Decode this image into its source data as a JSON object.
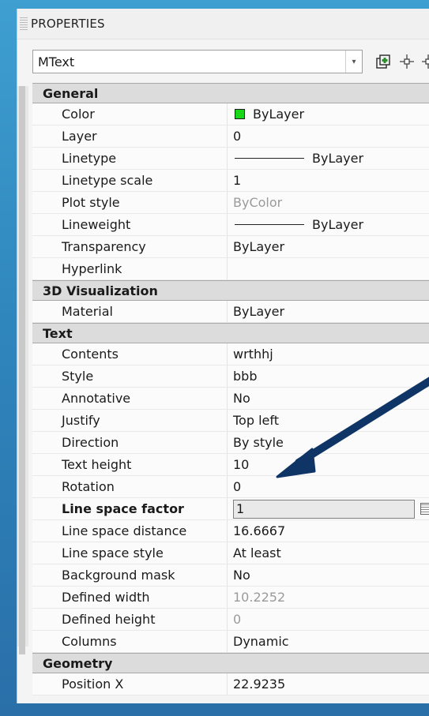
{
  "panel": {
    "title": "PROPERTIES"
  },
  "toolbar": {
    "selection": "MText",
    "buttons": [
      "quick-select-icon",
      "select-objects-icon",
      "toggle-pickadd-icon"
    ]
  },
  "sections": [
    {
      "title": "General",
      "collapse": "–",
      "rows": [
        {
          "name": "Color",
          "value": "ByLayer",
          "kind": "swatch",
          "swatch": "#19d619"
        },
        {
          "name": "Layer",
          "value": "0"
        },
        {
          "name": "Linetype",
          "value": "ByLayer",
          "kind": "line"
        },
        {
          "name": "Linetype scale",
          "value": "1"
        },
        {
          "name": "Plot style",
          "value": "ByColor",
          "gray": true
        },
        {
          "name": "Lineweight",
          "value": "ByLayer",
          "kind": "line"
        },
        {
          "name": "Transparency",
          "value": "ByLayer"
        },
        {
          "name": "Hyperlink",
          "value": ""
        }
      ]
    },
    {
      "title": "3D Visualization",
      "collapse": "–",
      "rows": [
        {
          "name": "Material",
          "value": "ByLayer"
        }
      ]
    },
    {
      "title": "Text",
      "collapse": "–",
      "rows": [
        {
          "name": "Contents",
          "value": "wrthhj"
        },
        {
          "name": "Style",
          "value": "bbb"
        },
        {
          "name": "Annotative",
          "value": "No"
        },
        {
          "name": "Justify",
          "value": "Top left"
        },
        {
          "name": "Direction",
          "value": "By style"
        },
        {
          "name": "Text height",
          "value": "10"
        },
        {
          "name": "Rotation",
          "value": "0"
        },
        {
          "name": "Line space factor",
          "value": "1",
          "kind": "edit",
          "bold": true
        },
        {
          "name": "Line space distance",
          "value": "16.6667"
        },
        {
          "name": "Line space style",
          "value": "At least"
        },
        {
          "name": "Background mask",
          "value": "No"
        },
        {
          "name": "Defined width",
          "value": "10.2252",
          "gray": true
        },
        {
          "name": "Defined height",
          "value": "0",
          "gray": true
        },
        {
          "name": "Columns",
          "value": "Dynamic"
        }
      ]
    },
    {
      "title": "Geometry",
      "collapse": "–",
      "rows": [
        {
          "name": "Position X",
          "value": "22.9235"
        }
      ]
    }
  ],
  "colors": {
    "annotation_arrow": "#0f3566",
    "background": "#2f86bd"
  }
}
